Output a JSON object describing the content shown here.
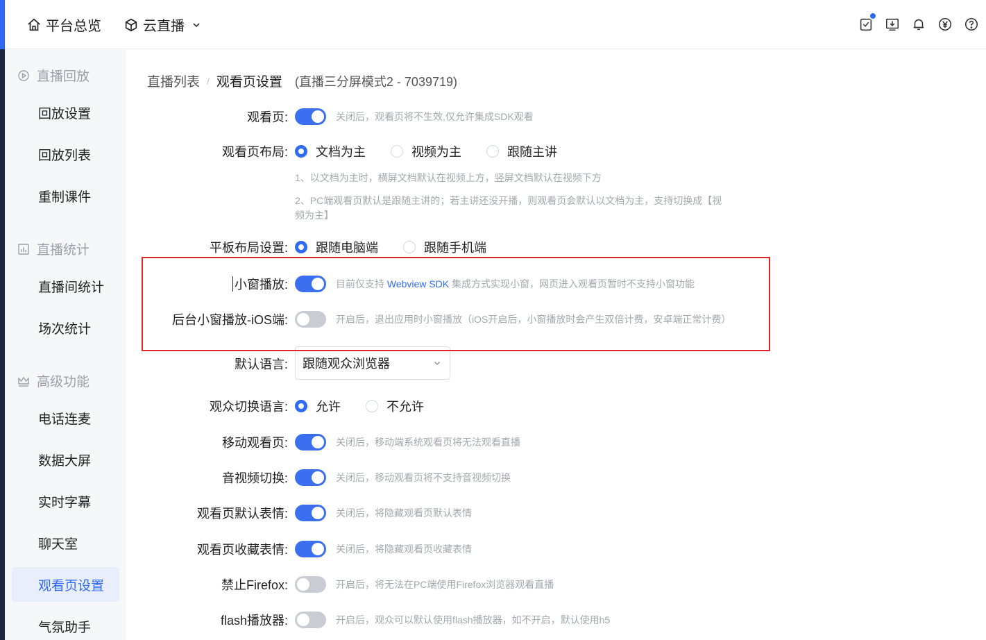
{
  "topbar": {
    "home_label": "平台总览",
    "live_label": "云直播",
    "icons": [
      "task-check-icon",
      "download-icon",
      "bell-icon",
      "yuan-icon",
      "help-icon"
    ]
  },
  "sidebar": {
    "groups": [
      {
        "label": "直播回放",
        "icon": "play-circle-icon",
        "items": [
          "回放设置",
          "回放列表",
          "重制课件"
        ]
      },
      {
        "label": "直播统计",
        "icon": "bar-chart-icon",
        "items": [
          "直播间统计",
          "场次统计"
        ]
      },
      {
        "label": "高级功能",
        "icon": "crown-icon",
        "items": [
          "电话连麦",
          "数据大屏",
          "实时字幕",
          "聊天室",
          "观看页设置",
          "气氛助手"
        ]
      }
    ],
    "active_item": "观看页设置"
  },
  "breadcrumb": {
    "parent": "直播列表",
    "separator": "/",
    "current": "观看页设置",
    "context": "(直播三分屏模式2 - 7039719)"
  },
  "settings": {
    "watch_page": {
      "label": "观看页:",
      "enabled": true,
      "hint": "关闭后，观看页将不生效,仅允许集成SDK观看"
    },
    "layout": {
      "label": "观看页布局:",
      "options": [
        "文档为主",
        "视频为主",
        "跟随主讲"
      ],
      "selected": "文档为主",
      "note1": "1、以文档为主时，横屏文档默认在视频上方，竖屏文档默认在视频下方",
      "note2": "2、PC端观看页默认是跟随主讲的；若主讲还没开播，则观看页会默认以文档为主，支持切换成【视频为主】"
    },
    "tablet_layout": {
      "label": "平板布局设置:",
      "options": [
        "跟随电脑端",
        "跟随手机端"
      ],
      "selected": "跟随电脑端"
    },
    "mini_window": {
      "label": "小窗播放:",
      "enabled": true,
      "hint_prefix": "目前仅支持 ",
      "hint_link": "Webview SDK",
      "hint_suffix": " 集成方式实现小窗，网页进入观看页暂时不支持小窗功能"
    },
    "bg_mini_window_ios": {
      "label": "后台小窗播放-iOS端:",
      "enabled": false,
      "hint": "开启后，退出应用时小窗播放（iOS开启后，小窗播放时会产生双倍计费，安卓端正常计费）"
    },
    "default_language": {
      "label": "默认语言:",
      "value": "跟随观众浏览器"
    },
    "audience_switch_language": {
      "label": "观众切换语言:",
      "options": [
        "允许",
        "不允许"
      ],
      "selected": "允许"
    },
    "mobile_watch_page": {
      "label": "移动观看页:",
      "enabled": true,
      "hint": "关闭后，移动端系统观看页将无法观看直播"
    },
    "av_switch": {
      "label": "音视频切换:",
      "enabled": true,
      "hint": "关闭后，移动观看页将不支持音视频切换"
    },
    "default_emoji": {
      "label": "观看页默认表情:",
      "enabled": true,
      "hint": "关闭后，将隐藏观看页默认表情"
    },
    "fav_emoji": {
      "label": "观看页收藏表情:",
      "enabled": true,
      "hint": "关闭后，将隐藏观看页收藏表情"
    },
    "block_firefox": {
      "label": "禁止Firefox:",
      "enabled": false,
      "hint": "开启后，将无法在PC端使用Firefox浏览器观看直播"
    },
    "flash_player": {
      "label": "flash播放器:",
      "enabled": false,
      "hint": "开启后，观众可以默认使用flash播放器，如不开启，默认使用h5"
    }
  },
  "colors": {
    "accent": "#2f6bf1",
    "highlight_border": "#e0242b",
    "toggle_off": "#c9ccd2",
    "hint_text": "#a3a7ae"
  }
}
